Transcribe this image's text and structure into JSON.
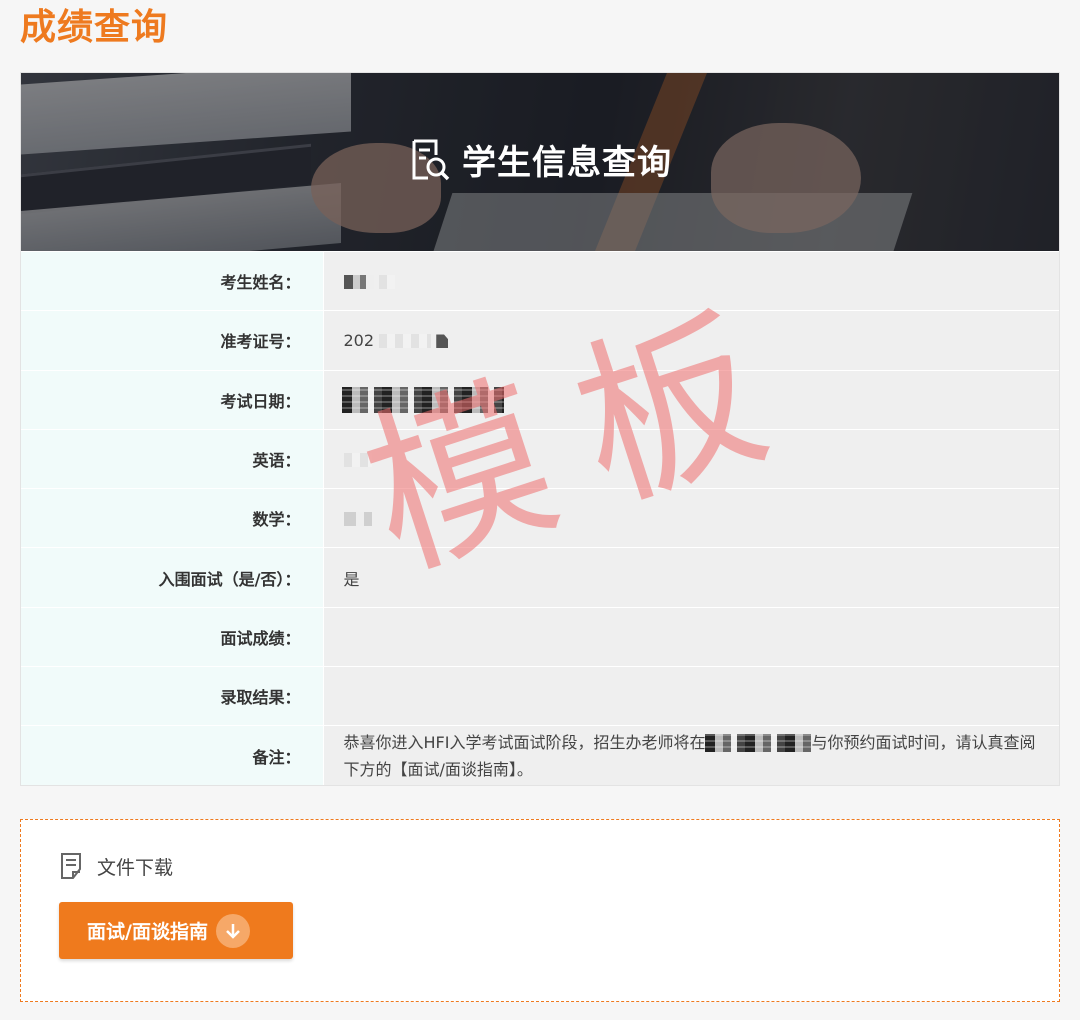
{
  "page_title": "成绩查询",
  "banner": {
    "heading": "学生信息查询",
    "icon": "document-search-icon"
  },
  "rows": [
    {
      "label": "考生姓名：",
      "value": ""
    },
    {
      "label": "准考证号：",
      "value": "202"
    },
    {
      "label": "考试日期：",
      "value": ""
    },
    {
      "label": "英语：",
      "value": ""
    },
    {
      "label": "数学：",
      "value": ""
    },
    {
      "label": "入围面试（是/否）：",
      "value": "是"
    },
    {
      "label": "面试成绩：",
      "value": ""
    },
    {
      "label": "录取结果：",
      "value": ""
    },
    {
      "label": "备注：",
      "value_part1": "恭喜你进入HFI入学考试面试阶段，招生办老师将在",
      "value_part2": "与你预约面试时间，请认真查阅下方的【面试/面谈指南】。"
    }
  ],
  "watermark": "模板",
  "download": {
    "heading": "文件下载",
    "heading_icon": "document-icon",
    "button_label": "面试/面谈指南",
    "button_icon": "download-arrow-icon"
  },
  "colors": {
    "accent": "#ee7a1f",
    "label_bg": "#f1fbfa",
    "value_bg": "#efefef"
  }
}
